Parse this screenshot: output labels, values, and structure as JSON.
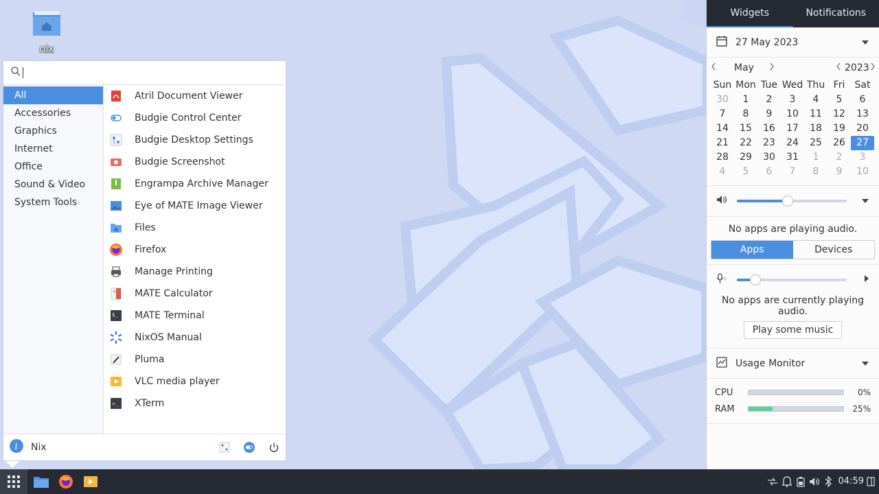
{
  "desktop": {
    "icon_label": "nix"
  },
  "menu": {
    "search": {
      "value": "",
      "placeholder": ""
    },
    "categories": [
      "All",
      "Accessories",
      "Graphics",
      "Internet",
      "Office",
      "Sound & Video",
      "System Tools"
    ],
    "active_category": "All",
    "apps": [
      {
        "label": "Atril Document Viewer",
        "icon": "pdf-icon"
      },
      {
        "label": "Budgie Control Center",
        "icon": "toggle-icon"
      },
      {
        "label": "Budgie Desktop Settings",
        "icon": "settings-icon"
      },
      {
        "label": "Budgie Screenshot",
        "icon": "camera-icon"
      },
      {
        "label": "Engrampa Archive Manager",
        "icon": "archive-icon"
      },
      {
        "label": "Eye of MATE Image Viewer",
        "icon": "image-icon"
      },
      {
        "label": "Files",
        "icon": "folder-icon"
      },
      {
        "label": "Firefox",
        "icon": "firefox-icon"
      },
      {
        "label": "Manage Printing",
        "icon": "printer-icon"
      },
      {
        "label": "MATE Calculator",
        "icon": "calculator-icon"
      },
      {
        "label": "MATE Terminal",
        "icon": "terminal-icon"
      },
      {
        "label": "NixOS Manual",
        "icon": "nixos-icon"
      },
      {
        "label": "Pluma",
        "icon": "text-editor-icon"
      },
      {
        "label": "VLC media player",
        "icon": "vlc-icon"
      },
      {
        "label": "XTerm",
        "icon": "xterm-icon"
      }
    ],
    "footer": {
      "user": "Nix"
    }
  },
  "raven": {
    "tabs": [
      "Widgets",
      "Notifications"
    ],
    "active_tab": "Widgets",
    "calendar": {
      "date_label": "27 May 2023",
      "month": "May",
      "year": "2023",
      "weekdays": [
        "Sun",
        "Mon",
        "Tue",
        "Wed",
        "Thu",
        "Fri",
        "Sat"
      ],
      "days": [
        [
          "30",
          "1",
          "2",
          "3",
          "4",
          "5",
          "6"
        ],
        [
          "7",
          "8",
          "9",
          "10",
          "11",
          "12",
          "13"
        ],
        [
          "14",
          "15",
          "16",
          "17",
          "18",
          "19",
          "20"
        ],
        [
          "21",
          "22",
          "23",
          "24",
          "25",
          "26",
          "27"
        ],
        [
          "28",
          "29",
          "30",
          "31",
          "1",
          "2",
          "3"
        ],
        [
          "4",
          "5",
          "6",
          "7",
          "8",
          "9",
          "10"
        ]
      ],
      "selected_day": "27"
    },
    "audio_output": {
      "volume_fraction": 0.46,
      "message": "No apps are playing audio.",
      "seg_apps": "Apps",
      "seg_devices": "Devices"
    },
    "audio_input": {
      "volume_fraction": 0.17,
      "message": "No apps are currently playing audio.",
      "button": "Play some music"
    },
    "usage_monitor": {
      "title": "Usage Monitor",
      "cpu_label": "CPU",
      "cpu_value": "0%",
      "cpu_fraction": 0.0,
      "ram_label": "RAM",
      "ram_value": "25%",
      "ram_fraction": 0.25
    }
  },
  "taskbar": {
    "clock": "04:59"
  },
  "colors": {
    "accent": "#4a8ee0",
    "panel": "#262a33",
    "ram_bar": "#5fcf9a"
  }
}
